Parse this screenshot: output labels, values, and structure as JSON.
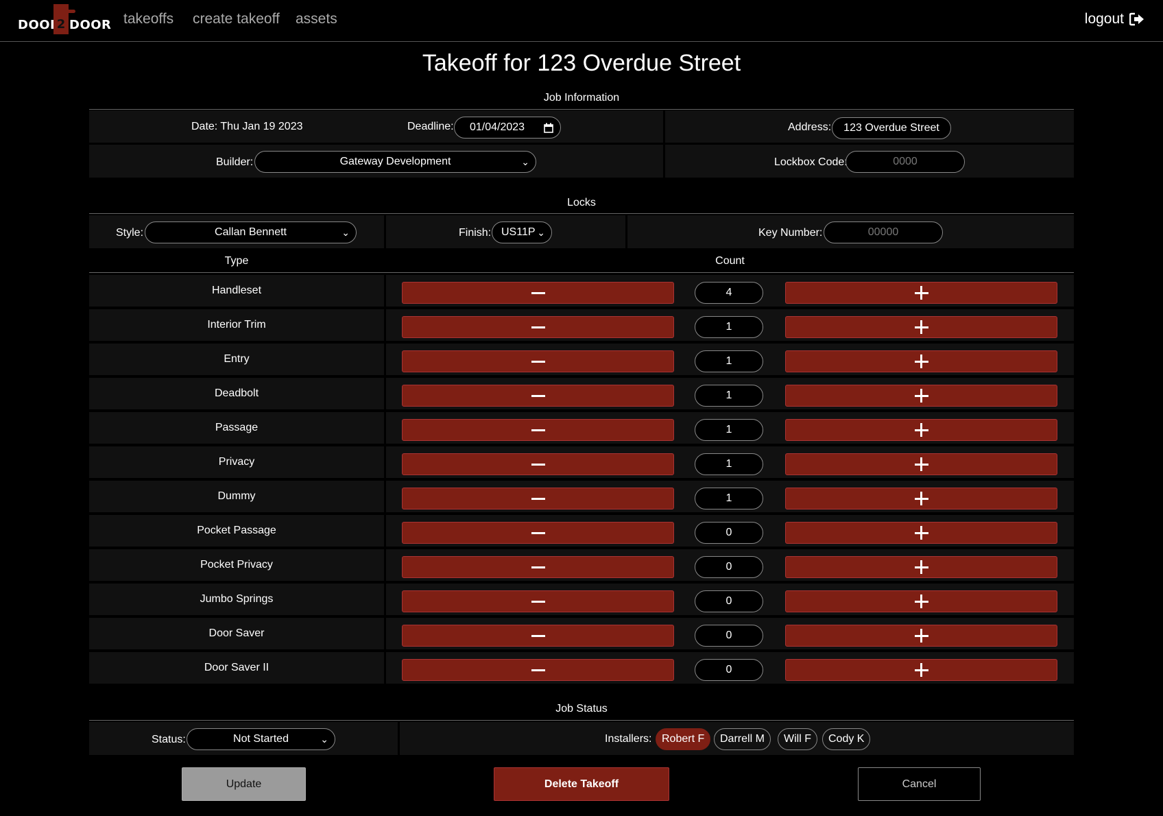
{
  "nav": {
    "logo_left": "DOOR",
    "logo_mid": "2",
    "logo_right": "DOOR",
    "links": [
      "takeoffs",
      "create takeoff",
      "assets"
    ],
    "logout": "logout"
  },
  "page_title": "Takeoff for 123 Overdue Street",
  "job_info": {
    "heading": "Job Information",
    "date": "Date: Thu Jan 19 2023",
    "deadline_label": "Deadline:",
    "deadline_value": "01/04/2023",
    "address_label": "Address:",
    "address_value": "123 Overdue Street",
    "builder_label": "Builder:",
    "builder_value": "Gateway Development",
    "lockbox_label": "Lockbox Code:",
    "lockbox_placeholder": "0000"
  },
  "locks": {
    "heading": "Locks",
    "style_label": "Style:",
    "style_value": "Callan Bennett",
    "finish_label": "Finish:",
    "finish_value": "US11P",
    "key_label": "Key Number:",
    "key_placeholder": "00000",
    "col_type": "Type",
    "col_count": "Count",
    "rows": [
      {
        "type": "Handleset",
        "count": "4"
      },
      {
        "type": "Interior Trim",
        "count": "1"
      },
      {
        "type": "Entry",
        "count": "1"
      },
      {
        "type": "Deadbolt",
        "count": "1"
      },
      {
        "type": "Passage",
        "count": "1"
      },
      {
        "type": "Privacy",
        "count": "1"
      },
      {
        "type": "Dummy",
        "count": "1"
      },
      {
        "type": "Pocket Passage",
        "count": "0"
      },
      {
        "type": "Pocket Privacy",
        "count": "0"
      },
      {
        "type": "Jumbo Springs",
        "count": "0"
      },
      {
        "type": "Door Saver",
        "count": "0"
      },
      {
        "type": "Door Saver II",
        "count": "0"
      }
    ]
  },
  "job_status": {
    "heading": "Job Status",
    "status_label": "Status:",
    "status_value": "Not Started",
    "installers_label": "Installers:",
    "installers": [
      {
        "name": "Robert F",
        "selected": true
      },
      {
        "name": "Darrell M",
        "selected": false
      },
      {
        "name": "Will F",
        "selected": false
      },
      {
        "name": "Cody K",
        "selected": false
      }
    ]
  },
  "actions": {
    "update": "Update",
    "delete": "Delete Takeoff",
    "cancel": "Cancel"
  },
  "colors": {
    "accent": "#7e1f14",
    "background": "#000000",
    "panel": "#111111"
  }
}
